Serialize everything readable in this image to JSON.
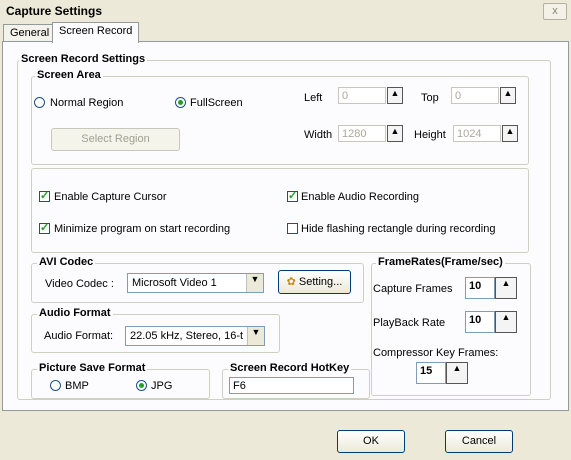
{
  "window": {
    "title": "Capture Settings",
    "close": "x"
  },
  "tabs": [
    {
      "label": "General"
    },
    {
      "label": "Screen Record"
    }
  ],
  "screen_record": {
    "group_title": "Screen Record Settings",
    "screen_area": {
      "title": "Screen Area",
      "normal_region": "Normal Region",
      "fullscreen": "FullScreen",
      "select_region": "Select Region",
      "left_label": "Left",
      "left_value": "0",
      "top_label": "Top",
      "top_value": "0",
      "width_label": "Width",
      "width_value": "1280",
      "height_label": "Height",
      "height_value": "1024"
    },
    "options": {
      "enable_cursor": "Enable Capture Cursor",
      "enable_audio": "Enable Audio Recording",
      "minimize": "Minimize program on start recording",
      "hide_rect": "Hide flashing rectangle during recording"
    },
    "avi_codec": {
      "title": "AVI Codec",
      "video_label": "Video Codec :",
      "video_value": "Microsoft Video 1",
      "setting_button": "Setting..."
    },
    "audio_format": {
      "title": "Audio Format",
      "label": "Audio Format:",
      "value": "22.05 kHz, Stereo, 16-t"
    },
    "framerates": {
      "title": "FrameRates(Frame/sec)",
      "capture_label": "Capture Frames",
      "capture_value": "10",
      "playback_label": "PlayBack Rate",
      "playback_value": "10",
      "key_label": "Compressor Key Frames:",
      "key_value": "15"
    },
    "picture_format": {
      "title": "Picture Save Format",
      "bmp": "BMP",
      "jpg": "JPG"
    },
    "hotkey": {
      "title": "Screen Record HotKey",
      "value": "F6"
    }
  },
  "footer": {
    "ok": "OK",
    "cancel": "Cancel"
  }
}
